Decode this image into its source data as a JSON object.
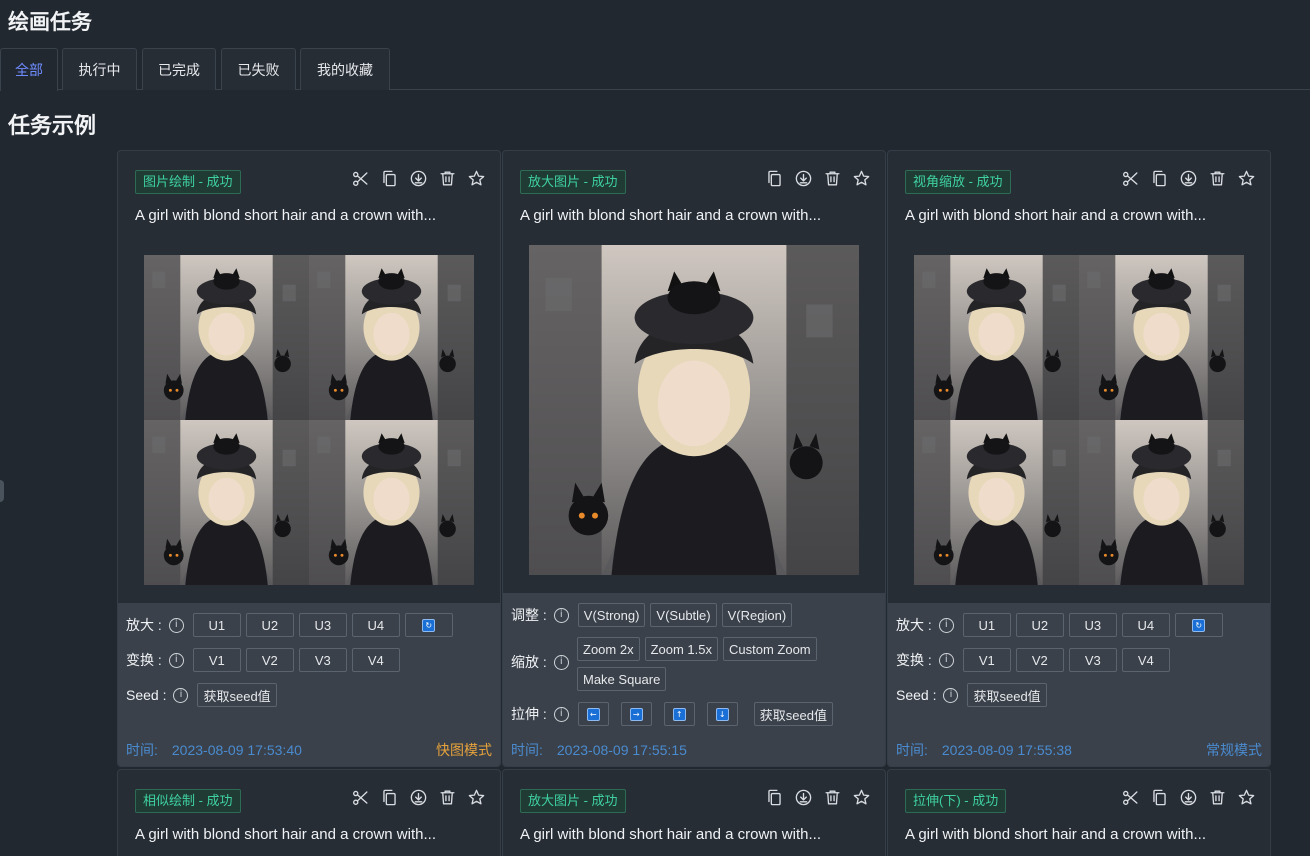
{
  "page": {
    "title": "绘画任务",
    "section_title": "任务示例"
  },
  "tabs": [
    {
      "label": "全部",
      "active": true
    },
    {
      "label": "执行中"
    },
    {
      "label": "已完成"
    },
    {
      "label": "已失败"
    },
    {
      "label": "我的收藏"
    }
  ],
  "labels": {
    "upscale": "放大 :",
    "variation": "变换 :",
    "seed": "Seed :",
    "adjust": "调整 :",
    "zoom": "缩放 :",
    "pan": "拉伸 :",
    "time": "时间:",
    "get_seed": "获取seed值"
  },
  "grid_buttons": {
    "upscale": [
      "U1",
      "U2",
      "U3",
      "U4"
    ],
    "variation": [
      "V1",
      "V2",
      "V3",
      "V4"
    ],
    "reroll_icon": "refresh-icon"
  },
  "upscaled_buttons": {
    "adjust": [
      "V(Strong)",
      "V(Subtle)",
      "V(Region)"
    ],
    "zoom": [
      "Zoom 2x",
      "Zoom 1.5x",
      "Custom Zoom",
      "Make Square"
    ],
    "pan_icons": [
      "arrow-left-icon",
      "arrow-right-icon",
      "arrow-up-icon",
      "arrow-down-icon"
    ]
  },
  "cards": [
    {
      "badge": "图片绘制 - 成功",
      "prompt": "A girl with blond short hair and a crown with...",
      "time": "2023-08-09 17:53:40",
      "mode": "快图模式"
    },
    {
      "badge": "放大图片 - 成功",
      "prompt": "A girl with blond short hair and a crown with...",
      "time": "2023-08-09 17:55:15",
      "mode": ""
    },
    {
      "badge": "视角缩放 - 成功",
      "prompt": "A girl with blond short hair and a crown with...",
      "time": "2023-08-09 17:55:38",
      "mode": "常规模式"
    },
    {
      "badge": "相似绘制 - 成功",
      "prompt": "A girl with blond short hair and a crown with..."
    },
    {
      "badge": "放大图片 - 成功",
      "prompt": "A girl with blond short hair and a crown with..."
    },
    {
      "badge": "拉伸(下) - 成功",
      "prompt": "A girl with blond short hair and a crown with..."
    }
  ],
  "colors": {
    "bg": "#212830",
    "card": "#262d35",
    "controls": "#3a414a",
    "accent": "#6f8cff",
    "success": "#3fd2a0",
    "time": "#4a8bd0",
    "quick_mode": "#e6a23c"
  }
}
